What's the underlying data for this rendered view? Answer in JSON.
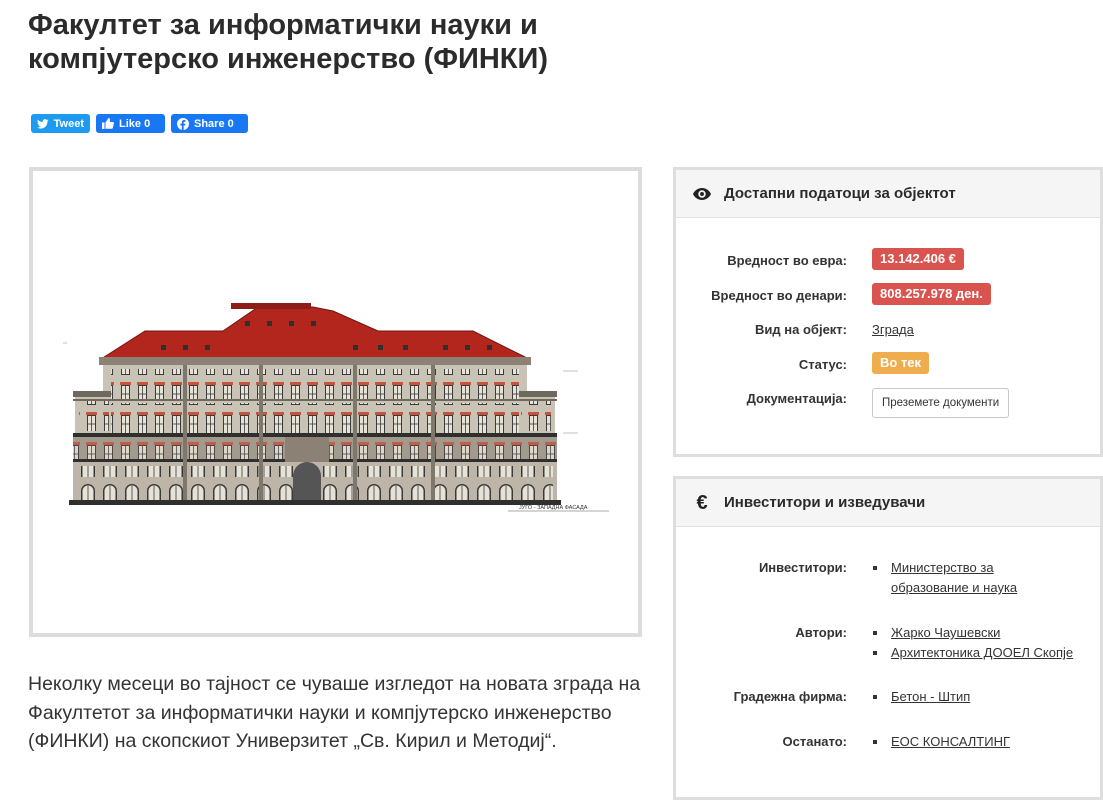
{
  "page": {
    "title": "Факултет за информатички науки и компјутерско инженерство (ФИНКИ)",
    "lead": "Неколку месеци во тајност се чуваше изгледот на новата зграда на Факултетот за информатички науки и компјутерско инженерство (ФИНКИ) на скопскиот Универзитет „Св. Кирил и Методиј“."
  },
  "share": {
    "tweet": "Tweet",
    "like": "Like 0",
    "share": "Share 0"
  },
  "image": {
    "caption": "ЈУГО - ЗАПАДНА ФАСАДА",
    "icon": "building-facade-drawing"
  },
  "info_panel": {
    "title": "Достапни податоци за објектот",
    "icon": "eye-icon",
    "rows": [
      {
        "label": "Вредност во евра:",
        "value": "13.142.406 €"
      },
      {
        "label": "Вредност во денари:",
        "value": "808.257.978 ден."
      },
      {
        "label": "Вид на објект:",
        "value": "Зграда"
      },
      {
        "label": "Статус:",
        "value": "Во тек"
      },
      {
        "label": "Документација:",
        "value": "Преземете документи"
      }
    ]
  },
  "investors_panel": {
    "title": "Инвеститори и изведувачи",
    "icon": "euro-icon",
    "investors_label": "Инвеститори:",
    "investors": [
      "Министерство за образование и наука"
    ],
    "authors_label": "Автори:",
    "authors": [
      "Жарко Чаушевски",
      "Архитектоника ДООЕЛ Скопје"
    ],
    "builder_label": "Градежна фирма:",
    "builders": [
      "Бетон - Штип"
    ],
    "other_label": "Останато:",
    "other": [
      "ЕОС КОНСАЛТИНГ"
    ]
  },
  "colors": {
    "badge_red": "#d9534f",
    "badge_orange": "#f0ad4e",
    "twitter": "#1d9bf0",
    "facebook": "#1877f2"
  }
}
